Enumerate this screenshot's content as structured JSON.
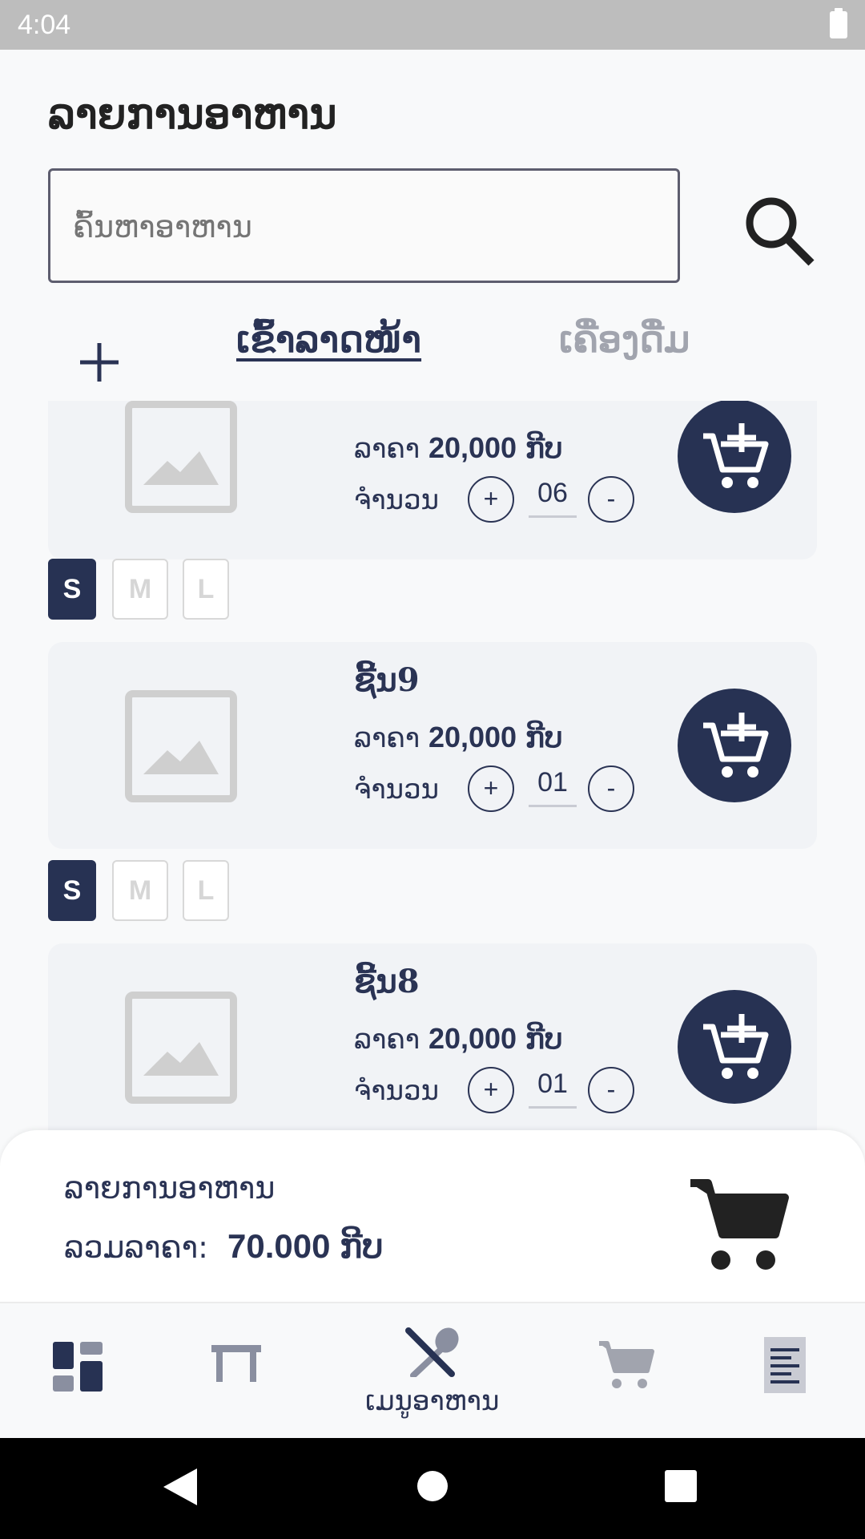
{
  "status_bar": {
    "time": "4:04"
  },
  "header": {
    "title": "ລາຍການອາຫານ"
  },
  "search": {
    "placeholder": "ຄົ້ນຫາອາຫານ"
  },
  "tabs": [
    {
      "label": "ເຂົ້າລາດໜ້າ",
      "active": true
    },
    {
      "label": "ເຄື່ອງດື່ມ",
      "active": false
    }
  ],
  "items": [
    {
      "name": "",
      "price_label": "ລາຄາ",
      "price": "20,000",
      "currency": "ກີບ",
      "qty_label": "ຈຳນວນ",
      "qty": "06",
      "sizes": [
        "S",
        "M",
        "L"
      ],
      "selected_size": "S"
    },
    {
      "name": "ຊີ້ນ9",
      "price_label": "ລາຄາ",
      "price": "20,000",
      "currency": "ກີບ",
      "qty_label": "ຈຳນວນ",
      "qty": "01",
      "sizes": [
        "S",
        "M",
        "L"
      ],
      "selected_size": "S"
    },
    {
      "name": "ຊີ້ນ8",
      "price_label": "ລາຄາ",
      "price": "20,000",
      "currency": "ກີບ",
      "qty_label": "ຈຳນວນ",
      "qty": "01",
      "sizes": [],
      "selected_size": ""
    }
  ],
  "qty_controls": {
    "plus": "+",
    "minus": "-"
  },
  "summary": {
    "title": "ລາຍການອາຫານ",
    "total_label": "ລວມລາຄາ:",
    "total": "70.000",
    "currency": "ກີບ"
  },
  "bottom_nav": [
    {
      "icon": "dashboard-icon",
      "label": "",
      "active": false
    },
    {
      "icon": "table-icon",
      "label": "",
      "active": false
    },
    {
      "icon": "food-menu-icon",
      "label": "ເມນູອາຫານ",
      "active": true
    },
    {
      "icon": "cart-icon",
      "label": "",
      "active": false
    },
    {
      "icon": "receipt-icon",
      "label": "",
      "active": false
    }
  ],
  "colors": {
    "primary": "#273253",
    "inactive": "#a1a4ae",
    "card_bg": "#f1f3f6"
  }
}
